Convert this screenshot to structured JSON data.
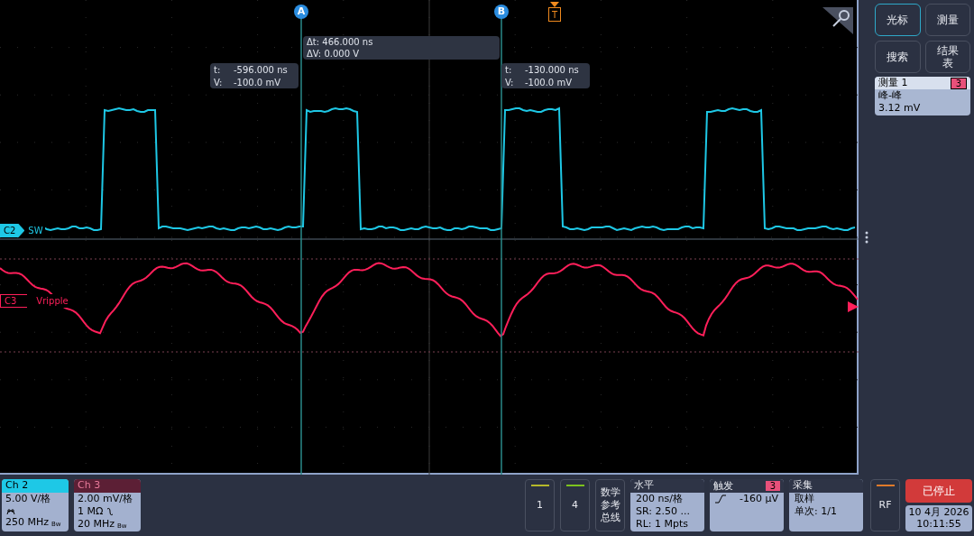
{
  "plot": {
    "channel_labels": [
      {
        "label": "C2",
        "name": "SW",
        "color": "#1ec8e6"
      },
      {
        "label": "C3",
        "name": "Vripple",
        "color": "#ff1f5a"
      }
    ],
    "cursors": [
      {
        "label": "A"
      },
      {
        "label": "B"
      }
    ],
    "trigger_marker": "T",
    "delta_readout": [
      "Δt: 466.000 ns",
      "ΔV: 0.000 V"
    ],
    "cursor_readouts": [
      {
        "t_label": "t:",
        "t": "-596.000 ns",
        "v_label": "V:",
        "v": "-100.0 mV"
      },
      {
        "t_label": "t:",
        "t": "-130.000 ns",
        "v_label": "V:",
        "v": "-100.0 mV"
      }
    ]
  },
  "side_panel": {
    "buttons": [
      {
        "label": "光标",
        "selected": true
      },
      {
        "label": "测量",
        "selected": false
      },
      {
        "label": "搜索",
        "selected": false
      },
      {
        "label": "结果表",
        "selected": false
      }
    ],
    "measurement": {
      "title": "测量 1",
      "source": "3",
      "type": "峰-峰",
      "value": "3.12 mV"
    }
  },
  "bottom_bar": {
    "channels": [
      {
        "title": "Ch 2",
        "scale": "5.00 V/格",
        "bandwidth": "250 MHz",
        "bw_mark": "Bw",
        "kind": "probe",
        "color": "#1ec8e6"
      },
      {
        "title": "Ch 3",
        "scale": "2.00 mV/格",
        "coupling": "1 MΩ",
        "bandwidth": "20 MHz",
        "bw_mark": "Bw",
        "kind": "coupling",
        "color": "#5c1f35"
      }
    ],
    "inactive_channels": [
      {
        "label": "1",
        "color": "#b5b82a"
      },
      {
        "label": "4",
        "color": "#7cc21e"
      }
    ],
    "math_button": "数学参考总线",
    "horizontal": {
      "title": "水平",
      "lines": [
        "200 ns/格",
        "SR: 2.50 ...",
        "RL: 1 Mpts"
      ]
    },
    "trigger": {
      "title": "触发",
      "source": "3",
      "level": "-160 μV"
    },
    "acquisition": {
      "title": "采集",
      "lines": [
        "取样",
        "单次: 1/1"
      ]
    },
    "rf": {
      "label": "RF"
    },
    "run_state": "已停止",
    "date": "10 4月 2026",
    "time": "10:11:55"
  }
}
